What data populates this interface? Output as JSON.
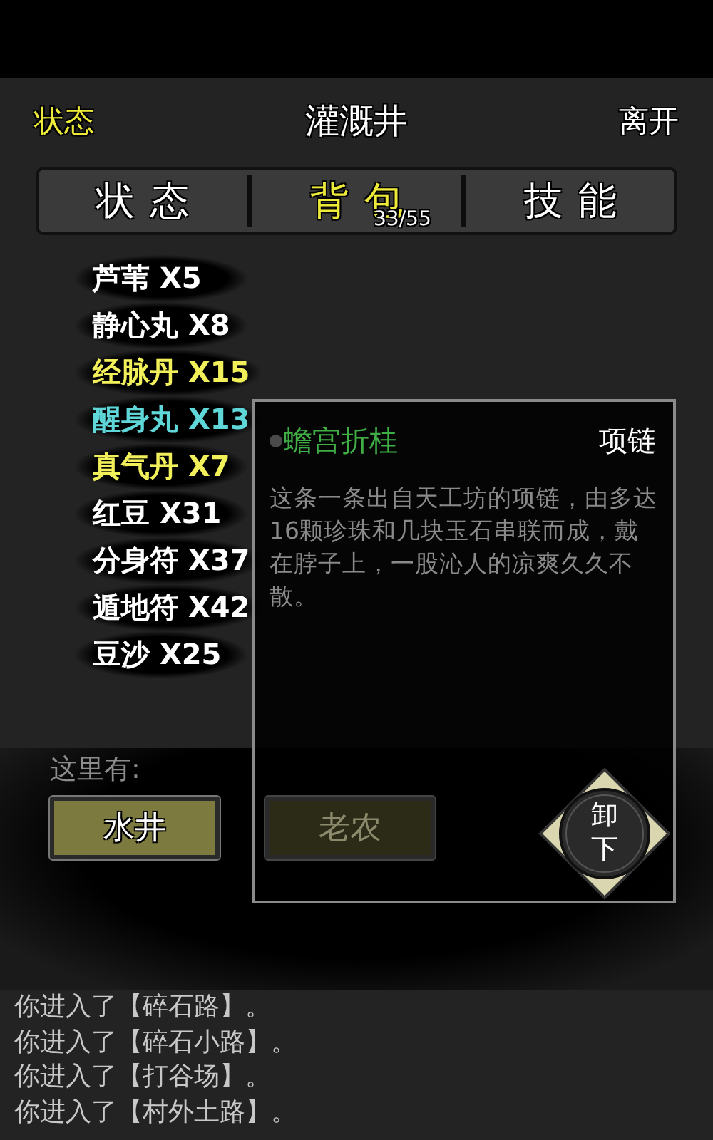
{
  "header": {
    "left_link": "状态",
    "title": "灌溉井",
    "right_link": "离开"
  },
  "tabs": [
    {
      "label": "状态",
      "selected": false
    },
    {
      "label": "背包",
      "selected": true,
      "badge": "33/55"
    },
    {
      "label": "技能",
      "selected": false
    }
  ],
  "inventory": [
    {
      "name": "芦苇 X5",
      "color": "#ffffff"
    },
    {
      "name": "静心丸 X8",
      "color": "#ffffff"
    },
    {
      "name": "经脉丹 X15",
      "color": "#f2f05a"
    },
    {
      "name": "醒身丸 X13",
      "color": "#5fd6d8"
    },
    {
      "name": "真气丹 X7",
      "color": "#f2f05a"
    },
    {
      "name": "红豆 X31",
      "color": "#ffffff"
    },
    {
      "name": "分身符 X37",
      "color": "#ffffff"
    },
    {
      "name": "遁地符 X42",
      "color": "#ffffff"
    },
    {
      "name": "豆沙 X25",
      "color": "#ffffff"
    }
  ],
  "location": {
    "label": "这里有:",
    "objects": [
      {
        "label": "水井",
        "selected": true
      },
      {
        "label": "老农",
        "selected": false
      }
    ]
  },
  "item_detail": {
    "name": "蟾宫折桂",
    "type": "项链",
    "description": "这条一条出自天工坊的项链，由多达16颗珍珠和几块玉石串联而成，戴在脖子上，一股沁人的凉爽久久不散。",
    "action": "卸下"
  },
  "log": [
    "你进入了【碎石路】。",
    "你进入了【碎石小路】。",
    "你进入了【打谷场】。",
    "你进入了【村外土路】。"
  ]
}
